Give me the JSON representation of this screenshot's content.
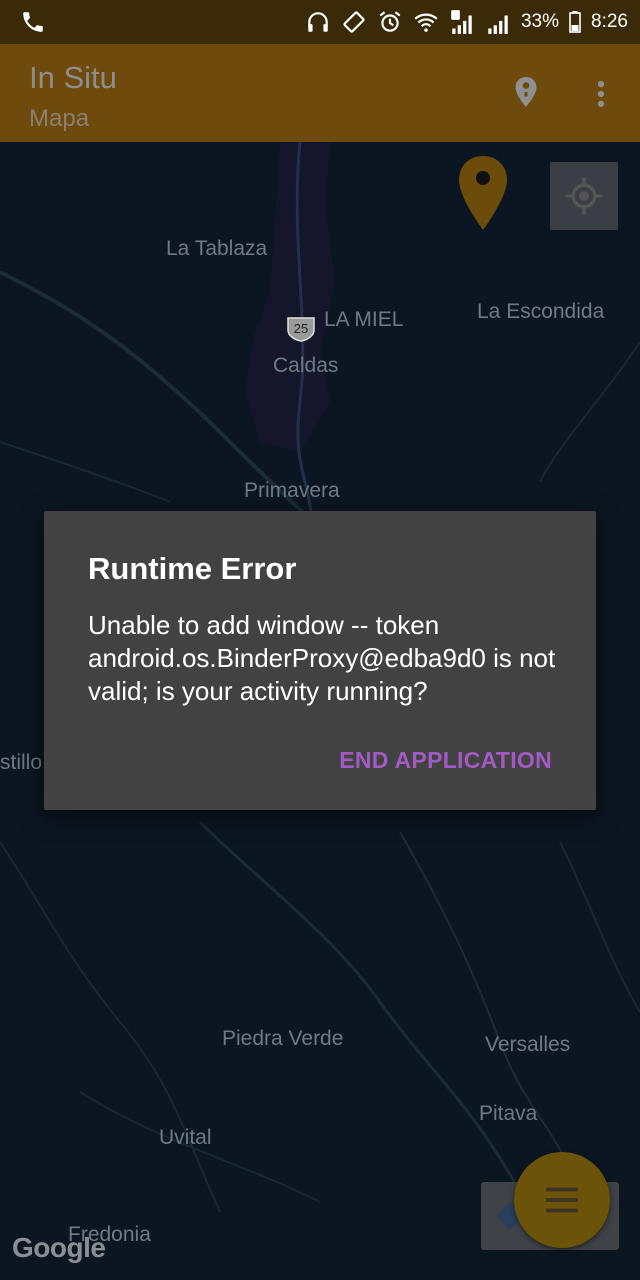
{
  "status_bar": {
    "battery": "33%",
    "time": "8:26",
    "icons": [
      "phone-icon",
      "headphones-icon",
      "vibrate-icon",
      "alarm-icon",
      "wifi-icon",
      "signal-sim1-icon",
      "signal-sim2-icon",
      "battery-icon"
    ]
  },
  "app_bar": {
    "title": "In Situ",
    "subtitle": "Mapa",
    "actions": [
      "place-pin-icon",
      "more-vert-icon"
    ]
  },
  "map": {
    "places": {
      "la_tablaza": "La Tablaza",
      "la_miel": "LA MIEL",
      "la_escondida": "La Escondida",
      "caldas": "Caldas",
      "primavera": "Primavera",
      "stillo": "stillo",
      "piedra_verde": "Piedra Verde",
      "versalles": "Versalles",
      "pitava": "Pitava",
      "uvital": "Uvital",
      "fredonia": "Fredonia"
    },
    "route_number": "25",
    "attribution": "Google"
  },
  "dialog": {
    "title": "Runtime Error",
    "message": "Unable to add window -- token android.os.BinderProxy@edba9d0 is not valid; is your activity running?",
    "button": "END APPLICATION"
  },
  "colors": {
    "app_bar": "#6e4a0c",
    "status_bar": "#3a2a08",
    "map_bg": "#0c1622",
    "dialog_bg": "#424242",
    "dialog_button": "#a35ac4",
    "fab": "#6b5309"
  }
}
